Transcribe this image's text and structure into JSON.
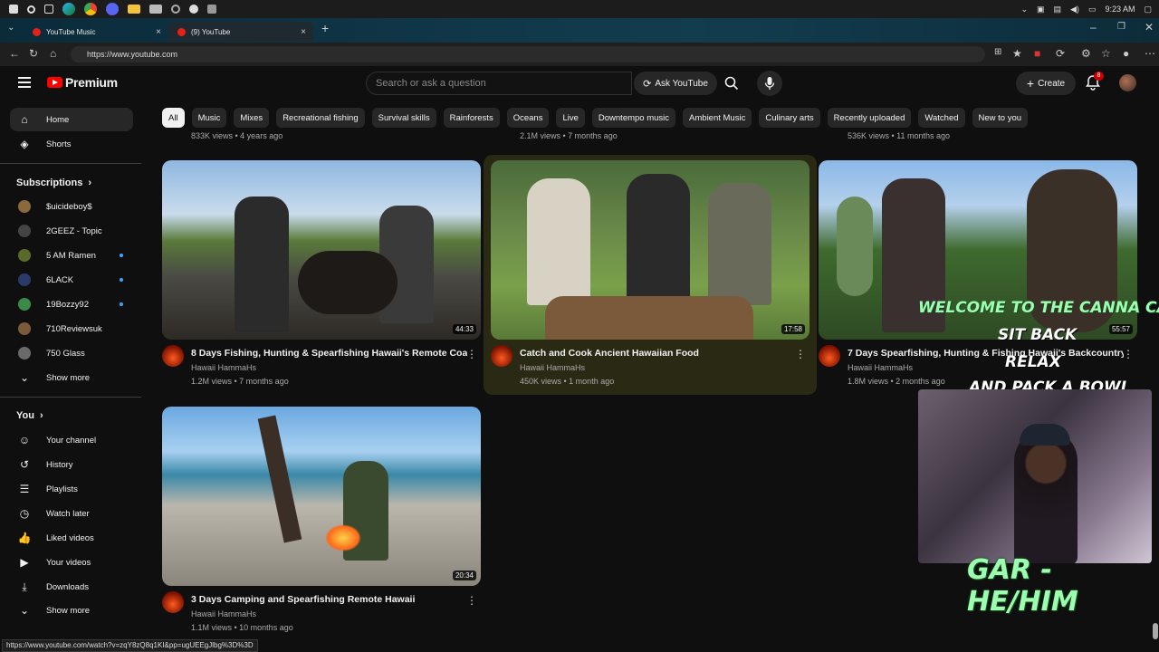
{
  "taskbar": {
    "time": "9:23 AM"
  },
  "browser": {
    "tabs": [
      {
        "label": "YouTube Music"
      },
      {
        "label": "(9) YouTube"
      }
    ],
    "url": "https://www.youtube.com",
    "status_url": "https://www.youtube.com/watch?v=zqY8zQ8q1KI&pp=ugUEEgJlbg%3D%3D"
  },
  "header": {
    "logo_text": "Premium",
    "search_placeholder": "Search or ask a question",
    "ask_label": "Ask YouTube",
    "create_label": "Create",
    "notif_count": "8"
  },
  "chips": [
    "All",
    "Music",
    "Mixes",
    "Recreational fishing",
    "Survival skills",
    "Rainforests",
    "Oceans",
    "Live",
    "Downtempo music",
    "Ambient Music",
    "Culinary arts",
    "Recently uploaded",
    "Watched",
    "New to you"
  ],
  "sidebar": {
    "main": [
      {
        "label": "Home",
        "icon": "home-icon"
      },
      {
        "label": "Shorts",
        "icon": "shorts-icon"
      }
    ],
    "subscriptions_title": "Subscriptions",
    "subscriptions": [
      {
        "label": "$uicideboy$",
        "dot": false,
        "color": "#8a6a3a"
      },
      {
        "label": "2GEEZ - Topic",
        "dot": false,
        "color": "#444444"
      },
      {
        "label": "5 AM Ramen",
        "dot": true,
        "color": "#5a6a2a"
      },
      {
        "label": "6LACK",
        "dot": true,
        "color": "#2a3a6a"
      },
      {
        "label": "19Bozzy92",
        "dot": true,
        "color": "#3a8a4a"
      },
      {
        "label": "710Reviewsuk",
        "dot": false,
        "color": "#7a5a3a"
      },
      {
        "label": "750 Glass",
        "dot": false,
        "color": "#6a6a6a"
      }
    ],
    "show_more": "Show more",
    "you_title": "You",
    "you_items": [
      {
        "label": "Your channel",
        "icon": "channel-icon"
      },
      {
        "label": "History",
        "icon": "history-icon"
      },
      {
        "label": "Playlists",
        "icon": "playlists-icon"
      },
      {
        "label": "Watch later",
        "icon": "watch-later-icon"
      },
      {
        "label": "Liked videos",
        "icon": "like-icon"
      },
      {
        "label": "Your videos",
        "icon": "your-videos-icon"
      },
      {
        "label": "Downloads",
        "icon": "download-icon"
      }
    ],
    "show_more_2": "Show more"
  },
  "prev_row": [
    "833K views • 4 years ago",
    "2.1M views • 7 months ago",
    "536K views • 11 months ago"
  ],
  "videos": [
    {
      "title": "8 Days Fishing, Hunting & Spearfishing Hawaii's Remote Coast",
      "channel": "Hawaii HammaHs",
      "meta": "1.2M views • 7 months ago",
      "duration": "44:33"
    },
    {
      "title": "Catch and Cook Ancient Hawaiian Food",
      "channel": "Hawaii HammaHs",
      "meta": "450K views • 1 month ago",
      "duration": "17:58"
    },
    {
      "title": "7 Days Spearfishing, Hunting & Fishing Hawaii's Backcountry",
      "channel": "Hawaii HammaHs",
      "meta": "1.8M views • 2 months ago",
      "duration": "55:57"
    },
    {
      "title": "3 Days Camping and Spearfishing Remote Hawaii",
      "channel": "Hawaii HammaHs",
      "meta": "1.1M views • 10 months ago",
      "duration": "20:34"
    }
  ],
  "stream_overlay": {
    "lines": [
      "WELCOME TO THE CANNA CABIN",
      "SIT BACK",
      "RELAX",
      "AND PACK A BOWL"
    ],
    "pronouns": "GAR - HE/HIM"
  },
  "colors": {
    "brand": "#ff0000",
    "overlay_text": "#9cffb0",
    "notif_badge": "#cc0000"
  }
}
